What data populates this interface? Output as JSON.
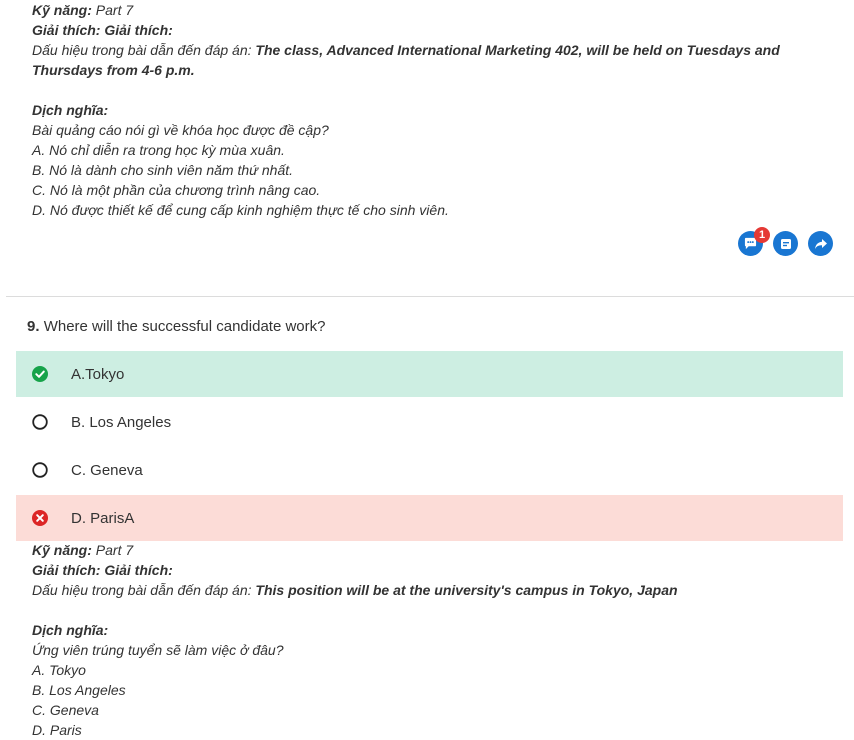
{
  "prev_explanation": {
    "skill_label": "Kỹ năng:",
    "skill_value": "Part 7",
    "expl_label": "Giải thích: Giải thích:",
    "clue_prefix": "Dấu hiệu trong bài dẫn đến đáp án:",
    "clue_bold": "The class, Advanced International Marketing 402, will be held on Tuesdays and Thursdays from 4-6 p.m.",
    "translation_label": "Dịch nghĩa:",
    "translation_lines": [
      "Bài quảng cáo nói gì về khóa học được đề cập?",
      "A. Nó chỉ diễn ra trong học kỳ mùa xuân.",
      "B. Nó là dành cho sinh viên năm thứ nhất.",
      "C. Nó là một phần của chương trình nâng cao.",
      "D. Nó được thiết kế để cung cấp kinh nghiệm thực tế cho sinh viên."
    ]
  },
  "actions": {
    "comment_badge": "1",
    "comment_icon": "chat-bubble-icon",
    "note_icon": "note-icon",
    "share_icon": "share-arrow-icon",
    "accent_color": "#1976d2",
    "badge_color": "#e53935"
  },
  "question": {
    "number": "9.",
    "text": "Where will the successful candidate work?",
    "options": [
      {
        "label": "A.Tokyo",
        "state": "correct"
      },
      {
        "label": "B. Los Angeles",
        "state": "unselected"
      },
      {
        "label": "C. Geneva",
        "state": "unselected"
      },
      {
        "label": "D. ParisA",
        "state": "wrong"
      }
    ],
    "correct_color": "#cdeee2",
    "wrong_color": "#fcdcd7"
  },
  "explanation": {
    "skill_label": "Kỹ năng:",
    "skill_value": "Part 7",
    "expl_label": "Giải thích: Giải thích:",
    "clue_prefix": "Dấu hiệu trong bài dẫn đến đáp án:",
    "clue_bold": "This position will be at the university's campus in Tokyo, Japan",
    "translation_label": "Dịch nghĩa:",
    "translation_lines": [
      "Ứng viên trúng tuyển sẽ làm việc ở đâu?",
      "A. Tokyo",
      "B. Los Angeles",
      "C. Geneva",
      "D. Paris"
    ]
  }
}
